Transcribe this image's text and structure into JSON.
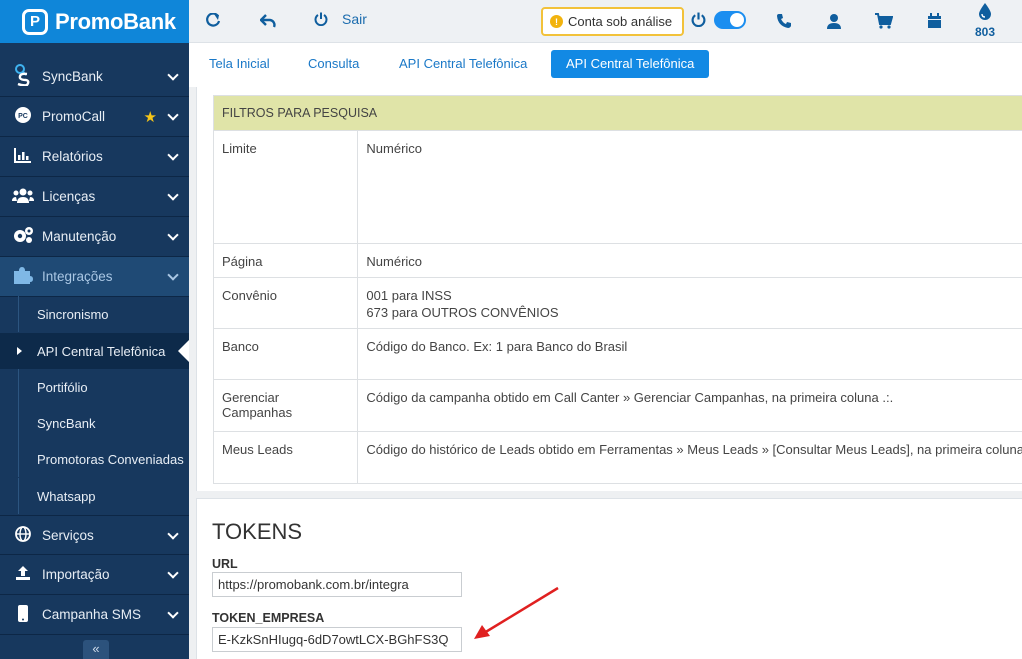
{
  "brand": {
    "logo_letter": "P",
    "name": "PromoBank"
  },
  "topbar": {
    "refresh_icon": "refresh-icon",
    "back_icon": "undo-arrow-icon",
    "sair_label": "Sair",
    "status_text": "Conta sob análise",
    "status_color": "#f2c23a",
    "drop_count": "803"
  },
  "sidebar": {
    "items": [
      {
        "label": "SyncBank",
        "icon": "syncbank-icon"
      },
      {
        "label": "PromoCall",
        "icon": "promocall-icon"
      },
      {
        "label": "Relatórios",
        "icon": "chart-icon"
      },
      {
        "label": "Licenças",
        "icon": "users-icon"
      },
      {
        "label": "Manutenção",
        "icon": "gears-icon"
      },
      {
        "label": "Integrações",
        "icon": "puzzle-icon"
      }
    ],
    "subitems": [
      {
        "label": "Sincronismo"
      },
      {
        "label": "API Central Telefônica"
      },
      {
        "label": "Portifólio"
      },
      {
        "label": "SyncBank"
      },
      {
        "label": "Promotoras Conveniadas"
      },
      {
        "label": "Whatsapp"
      }
    ],
    "bottom_items": [
      {
        "label": "Serviços",
        "icon": "globe-icon"
      },
      {
        "label": "Importação",
        "icon": "upload-icon"
      },
      {
        "label": "Campanha SMS",
        "icon": "mobile-icon"
      }
    ],
    "collapse_label": "«"
  },
  "tabs": [
    {
      "label": "Tela Inicial"
    },
    {
      "label": "Consulta"
    },
    {
      "label": "API Central Telefônica"
    },
    {
      "label": "API Central Telefônica"
    }
  ],
  "filters": {
    "header": "FILTROS PARA PESQUISA",
    "rows": [
      {
        "key": "Limite",
        "value": "Numérico"
      },
      {
        "key": "Página",
        "value": "Numérico"
      },
      {
        "key": "Convênio",
        "value": "001 para INSS",
        "value2": "673 para OUTROS CONVÊNIOS"
      },
      {
        "key": "Banco",
        "value": "Código do Banco. Ex: 1 para Banco do Brasil"
      },
      {
        "key": "Gerenciar Campanhas",
        "value": "Código da campanha obtido em Call Canter » Gerenciar Campanhas, na primeira coluna .:."
      },
      {
        "key": "Meus Leads",
        "value": "Código do histórico de Leads obtido em Ferramentas » Meus Leads » [Consultar Meus Leads], na primeira coluna"
      }
    ]
  },
  "tokens": {
    "title": "TOKENS",
    "url_label": "URL",
    "url_value": "https://promobank.com.br/integra",
    "token_label": "TOKEN_EMPRESA",
    "token_value": "E-KzkSnHIugq-6dD7owtLCX-BGhFS3Q",
    "arrow_color": "#e02020"
  }
}
